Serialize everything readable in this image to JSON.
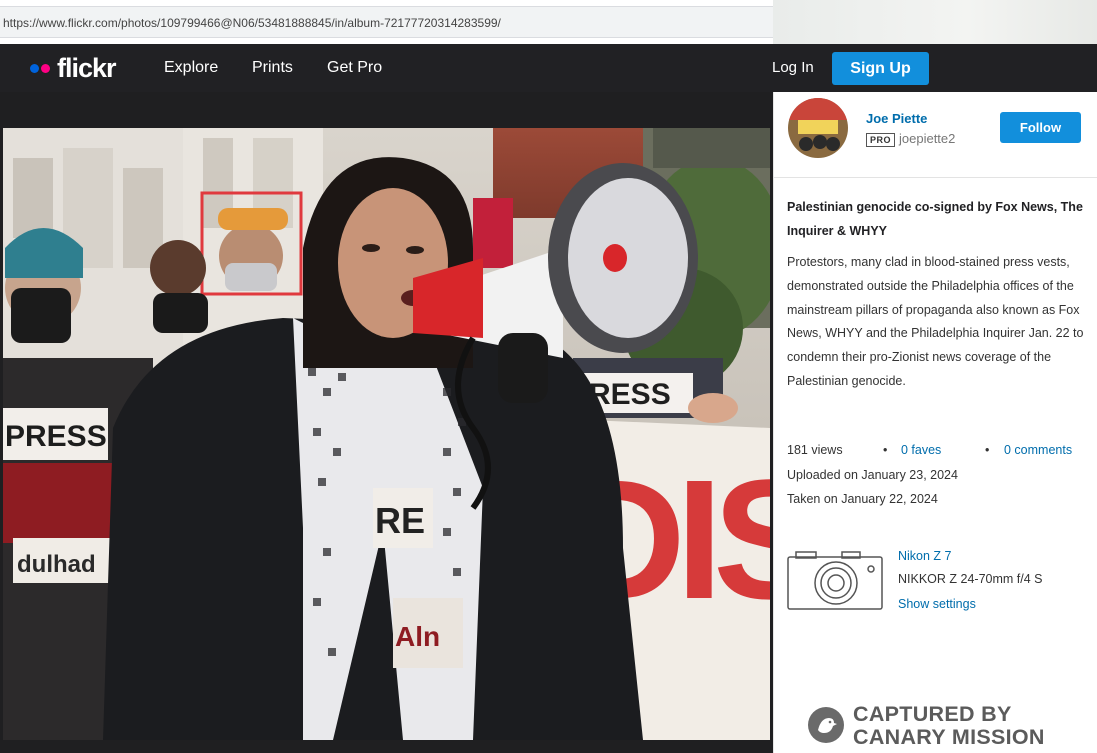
{
  "browser": {
    "url": "https://www.flickr.com/photos/109799466@N06/53481888845/in/album-72177720314283599/"
  },
  "nav": {
    "logo_text": "flickr",
    "links": [
      "Explore",
      "Prints",
      "Get Pro"
    ],
    "login_label": "Log In",
    "signup_label": "Sign Up"
  },
  "photo": {
    "sign_text_press": "PRESS",
    "banner_text": "DIS"
  },
  "author": {
    "name": "Joe Piette",
    "pro_badge": "PRO",
    "handle": "joepiette2",
    "follow_label": "Follow"
  },
  "photo_info": {
    "title": "Palestinian genocide co-signed by Fox News, The Inquirer & WHYY",
    "description": "Protestors, many clad in blood-stained press vests, demonstrated outside the Philadelphia offices of the mainstream pillars of propaganda also known as Fox News, WHYY and the Philadelphia Inquirer Jan. 22 to condemn their pro-Zionist news coverage of the Palestinian genocide.",
    "views": "181 views",
    "faves": "0 faves",
    "comments": "0 comments",
    "uploaded": "Uploaded on January 23, 2024",
    "taken": "Taken on January 22, 2024"
  },
  "camera": {
    "icon": "camera-icon",
    "model": "Nikon Z 7",
    "lens": "NIKKOR Z 24-70mm f/4 S",
    "settings_link": "Show settings"
  },
  "watermark": {
    "line1": "CAPTURED BY",
    "line2": "CANARY MISSION"
  },
  "colors": {
    "nav_bg": "#212124",
    "accent_blue": "#128fdc",
    "link_blue": "#006dac",
    "flickr_blue": "#0063dc",
    "flickr_pink": "#ff0084",
    "highlight_box": "#e0393e"
  }
}
